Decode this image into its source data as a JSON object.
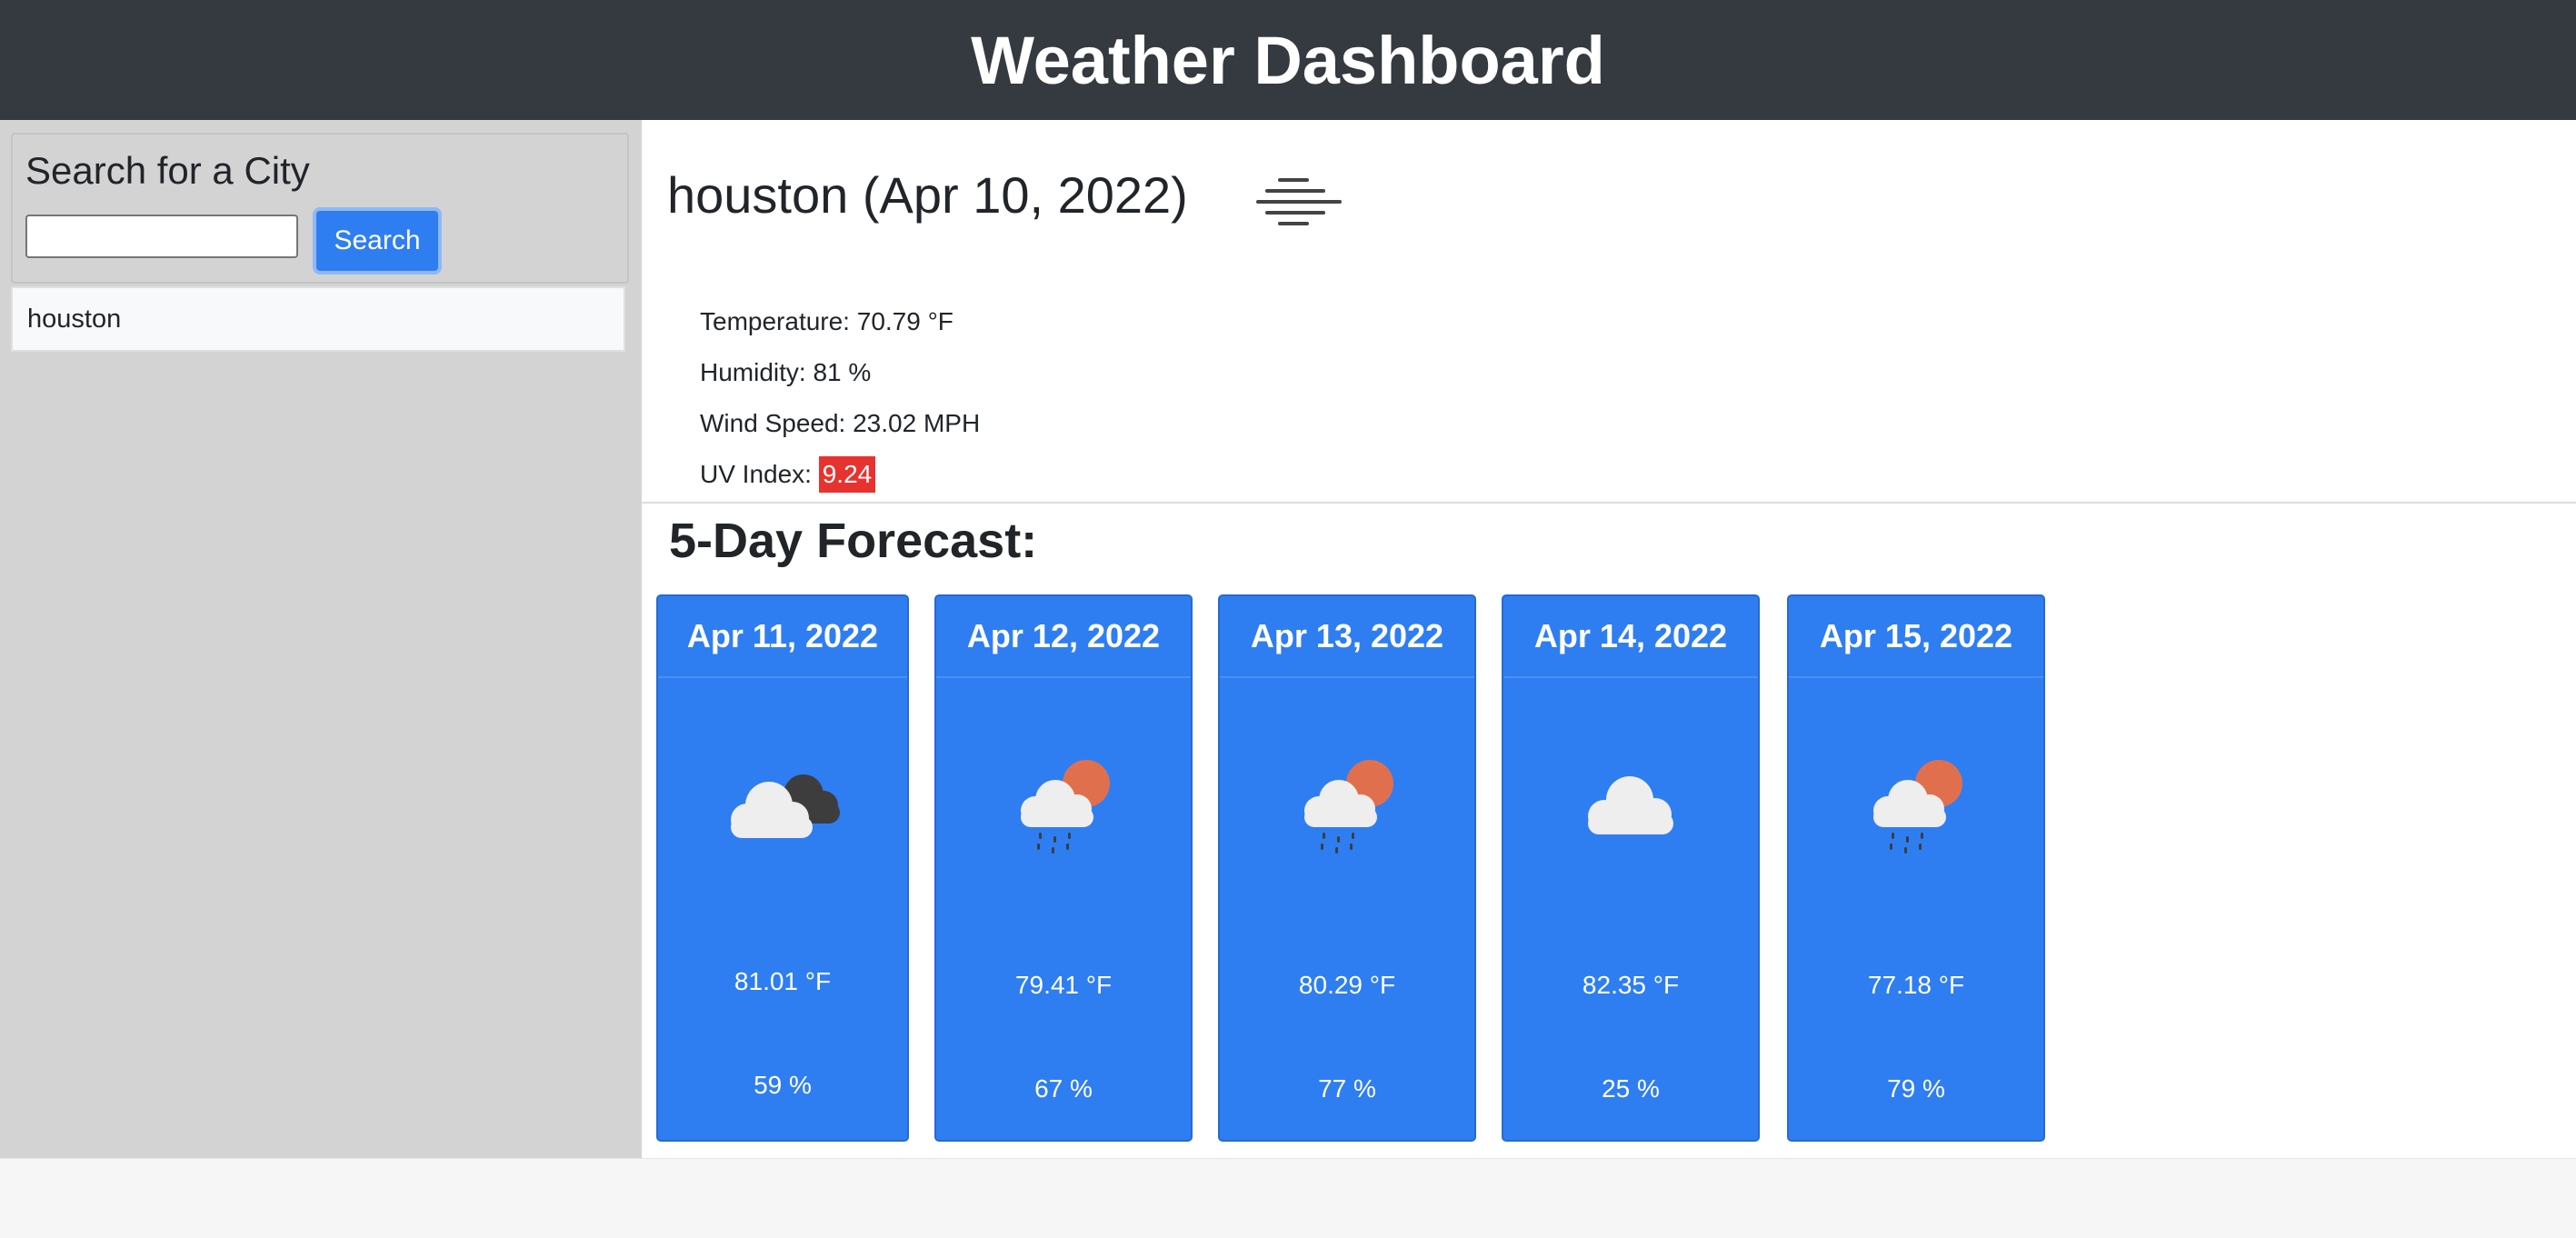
{
  "header": {
    "title": "Weather Dashboard"
  },
  "sidebar": {
    "search_title": "Search for a City",
    "search_value": "",
    "search_button": "Search",
    "history": [
      "houston"
    ]
  },
  "current": {
    "title": "houston (Apr 10, 2022)",
    "icon": "fog-icon",
    "temperature": "Temperature: 70.79 °F",
    "humidity": "Humidity: 81 %",
    "wind": "Wind Speed: 23.02 MPH",
    "uv_label": "UV Index: ",
    "uv_value": "9.24",
    "uv_color": "#e7332f"
  },
  "forecast": {
    "title": "5-Day Forecast:",
    "days": [
      {
        "date": "Apr 11, 2022",
        "icon": "broken-clouds-icon",
        "temp": "81.01 °F",
        "humidity": "59 %"
      },
      {
        "date": "Apr 12, 2022",
        "icon": "rain-sun-icon",
        "temp": "79.41 °F",
        "humidity": "67 %"
      },
      {
        "date": "Apr 13, 2022",
        "icon": "rain-sun-icon",
        "temp": "80.29 °F",
        "humidity": "77 %"
      },
      {
        "date": "Apr 14, 2022",
        "icon": "cloud-icon",
        "temp": "82.35 °F",
        "humidity": "25 %"
      },
      {
        "date": "Apr 15, 2022",
        "icon": "rain-sun-icon",
        "temp": "77.18 °F",
        "humidity": "79 %"
      }
    ]
  },
  "colors": {
    "header_bg": "#343a40",
    "card_bg": "#2f7ef1",
    "sidebar_bg": "#d3d3d3"
  }
}
